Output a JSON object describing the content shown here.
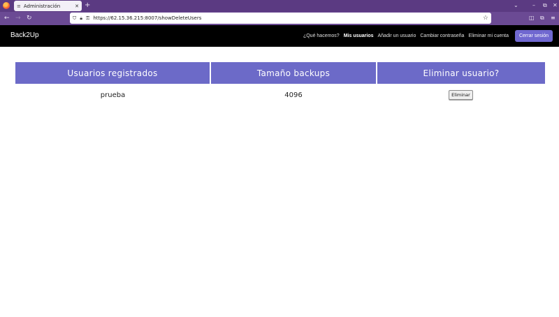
{
  "browser": {
    "tab_title": "Administración",
    "tab_icon": "list-icon",
    "url": "https://62.15.36.215:8007/showDeleteUsers",
    "accent": "#5b3a82"
  },
  "site": {
    "brand": "Back2Up",
    "nav": [
      {
        "label": "¿Qué hacemos?",
        "active": false
      },
      {
        "label": "Mis usuarios",
        "active": true
      },
      {
        "label": "Añadir un usuario",
        "active": false
      },
      {
        "label": "Cambiar contraseña",
        "active": false
      },
      {
        "label": "Eliminar mi cuenta",
        "active": false
      }
    ],
    "logout_label": "Cerrar sesión",
    "logout_color": "#7068d0"
  },
  "table": {
    "header_color": "#6c6ac8",
    "headers": [
      "Usuarios registrados",
      "Tamaño backups",
      "Eliminar usuario?"
    ],
    "rows": [
      {
        "user": "prueba",
        "size": "4096",
        "action": "Eliminar"
      }
    ]
  }
}
